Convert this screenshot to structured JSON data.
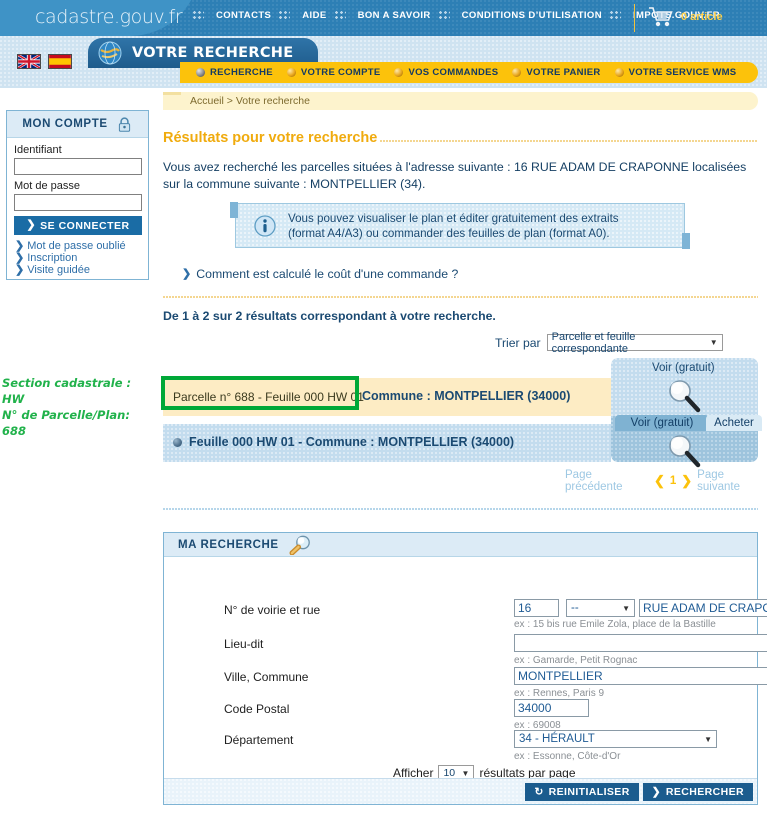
{
  "header": {
    "brand": "cadastre.gouv.fr",
    "nav": [
      {
        "label": "CONTACTS"
      },
      {
        "label": "AIDE"
      },
      {
        "label": "BON A SAVOIR"
      },
      {
        "label": "CONDITIONS D’UTILISATION"
      },
      {
        "label": "IMPOTS.GOUV.FR"
      }
    ],
    "cart": {
      "icon": "cart-icon",
      "count_label": "0 article"
    },
    "languages": [
      {
        "name": "flag-uk",
        "title": "English"
      },
      {
        "name": "flag-es",
        "title": "Español"
      }
    ],
    "rubric": {
      "icon": "globe-icon",
      "title": "VOTRE RECHERCHE"
    },
    "tabs": [
      {
        "label": "RECHERCHE",
        "active": true
      },
      {
        "label": "VOTRE COMPTE",
        "active": false
      },
      {
        "label": "VOS COMMANDES",
        "active": false
      },
      {
        "label": "VOTRE PANIER",
        "active": false
      },
      {
        "label": "VOTRE SERVICE WMS",
        "active": false
      }
    ]
  },
  "breadcrumb": {
    "text": "Accueil > Votre recherche"
  },
  "account": {
    "title": "MON COMPTE",
    "icon": "lock-icon",
    "identifiant_label": "Identifiant",
    "identifiant_value": "",
    "password_label": "Mot de passe",
    "password_value": "",
    "connect_label": "SE CONNECTER",
    "links": [
      {
        "label": "Mot de passe oublié"
      },
      {
        "label": "Inscription"
      },
      {
        "label": "Visite guidée"
      }
    ]
  },
  "results": {
    "title": "Résultats pour votre recherche",
    "intro": "Vous avez recherché les parcelles situées à l'adresse suivante : 16 RUE ADAM DE CRAPONNE localisées sur la commune suivante : MONTPELLIER (34).",
    "info_box": {
      "icon": "info-icon",
      "line1": "Vous pouvez visualiser le plan et éditer gratuitement des extraits",
      "line2": "(format A4/A3) ou commander des feuilles de plan (format A0)."
    },
    "cost_link": "Comment est calculé le coût d'une commande ?",
    "count_text": "De 1 à 2 sur 2 résultats correspondant à votre recherche.",
    "sort": {
      "label": "Trier par",
      "value": "Parcelle et feuille correspondante"
    },
    "rows": [
      {
        "parcel": "Parcelle n° 688 - Feuille 000 HW 01",
        "commune": "Commune : MONTPELLIER (34000)",
        "action_voir": "Voir (gratuit)",
        "action_icon": "magnifier-icon"
      },
      {
        "text": "Feuille 000 HW 01 - Commune : MONTPELLIER (34000)",
        "action_voir": "Voir (gratuit)",
        "action_acheter": "Acheter",
        "action_icon": "magnifier-icon"
      }
    ],
    "pagination": {
      "previous": "Page précédente",
      "current": "1",
      "next": "Page suivante"
    },
    "annotation": {
      "line1": "Section cadastrale : HW",
      "line2": "N° de Parcelle/Plan: 688",
      "color": "#21b24b"
    }
  },
  "search_form": {
    "title": "MA RECHERCHE",
    "icon": "magnifier-icon",
    "fields": [
      {
        "label": "N° de voirie et rue",
        "number_value": "16",
        "suffix_value": "--",
        "street_value": "RUE ADAM DE CRAPONNE",
        "hint": "ex : 15 bis rue Emile Zola, place de la Bastille",
        "help": "?"
      },
      {
        "label": "Lieu-dit",
        "value": "",
        "hint": "ex : Gamarde, Petit Rognac",
        "help": "?"
      },
      {
        "label": "Ville, Commune",
        "value": "MONTPELLIER",
        "hint": "ex : Rennes, Paris 9"
      },
      {
        "label": "Code Postal",
        "value": "34000",
        "hint": "ex : 69008"
      },
      {
        "label": "Département",
        "value": "34 - HÉRAULT",
        "hint": "ex : Essonne, Côte-d'Or"
      }
    ],
    "per_page": {
      "prefix": "Afficher",
      "value": "10",
      "suffix": "résultats par page"
    },
    "reset_label": "REINITIALISER",
    "submit_label": "RECHERCHER"
  },
  "colors": {
    "header_blue": "#2d7fb5",
    "nav_yellow": "#fcc20b",
    "accent_orange": "#f0ab0e",
    "text_blue": "#1b4a72",
    "annotation_green": "#21b24b",
    "row_highlight": "#fdecc4",
    "row_blue": "#c3dcee"
  }
}
